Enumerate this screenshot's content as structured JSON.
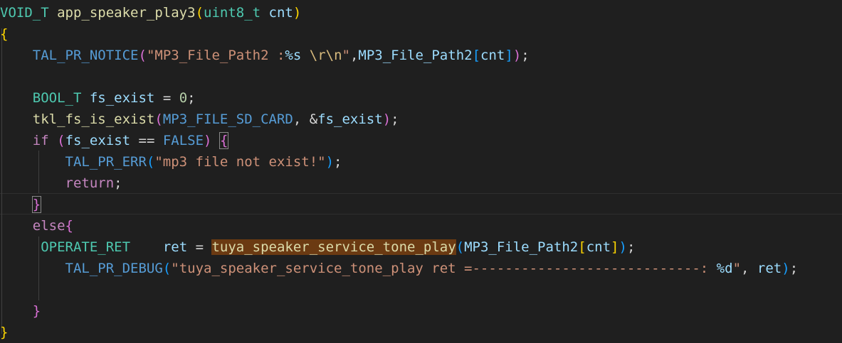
{
  "editor": {
    "lines": [
      {
        "tokens": [
          {
            "t": "VOID_T",
            "c": "kw-type"
          },
          {
            "t": " "
          },
          {
            "t": "app_speaker_play3",
            "c": "fn"
          },
          {
            "t": "(",
            "c": "b1"
          },
          {
            "t": "uint8_t",
            "c": "kw-type"
          },
          {
            "t": " "
          },
          {
            "t": "cnt",
            "c": "var"
          },
          {
            "t": ")",
            "c": "b1"
          }
        ]
      },
      {
        "tokens": [
          {
            "t": "{",
            "c": "b1"
          }
        ]
      },
      {
        "tokens": [
          {
            "t": "    "
          },
          {
            "t": "TAL_PR_NOTICE",
            "c": "mac"
          },
          {
            "t": "(",
            "c": "b2"
          },
          {
            "t": "\"MP3_File_Path2 :",
            "c": "str"
          },
          {
            "t": "%s",
            "c": "fmt"
          },
          {
            "t": " ",
            "c": "str"
          },
          {
            "t": "\\r\\n",
            "c": "esc"
          },
          {
            "t": "\"",
            "c": "str"
          },
          {
            "t": ","
          },
          {
            "t": "MP3_File_Path2",
            "c": "var"
          },
          {
            "t": "[",
            "c": "b3"
          },
          {
            "t": "cnt",
            "c": "var"
          },
          {
            "t": "]",
            "c": "b3"
          },
          {
            "t": ")",
            "c": "b2"
          },
          {
            "t": ";"
          }
        ]
      },
      {
        "tokens": []
      },
      {
        "tokens": [
          {
            "t": "    "
          },
          {
            "t": "BOOL_T",
            "c": "kw-type"
          },
          {
            "t": " "
          },
          {
            "t": "fs_exist",
            "c": "var"
          },
          {
            "t": " = "
          },
          {
            "t": "0",
            "c": "num"
          },
          {
            "t": ";"
          }
        ]
      },
      {
        "tokens": [
          {
            "t": "    "
          },
          {
            "t": "tkl_fs_is_exist",
            "c": "fn"
          },
          {
            "t": "(",
            "c": "b2"
          },
          {
            "t": "MP3_FILE_SD_CARD",
            "c": "mac"
          },
          {
            "t": ", &"
          },
          {
            "t": "fs_exist",
            "c": "var"
          },
          {
            "t": ")",
            "c": "b2"
          },
          {
            "t": ";"
          }
        ]
      },
      {
        "tokens": [
          {
            "t": "    "
          },
          {
            "t": "if",
            "c": "kw-ret"
          },
          {
            "t": " "
          },
          {
            "t": "(",
            "c": "b2"
          },
          {
            "t": "fs_exist",
            "c": "var"
          },
          {
            "t": " == "
          },
          {
            "t": "FALSE",
            "c": "mac"
          },
          {
            "t": ")",
            "c": "b2"
          },
          {
            "t": " "
          },
          {
            "t": "{",
            "c": "b2 hlb"
          }
        ]
      },
      {
        "tokens": [
          {
            "t": "        "
          },
          {
            "t": "TAL_PR_ERR",
            "c": "mac"
          },
          {
            "t": "(",
            "c": "b3"
          },
          {
            "t": "\"mp3 file not exist!\"",
            "c": "str"
          },
          {
            "t": ")",
            "c": "b3"
          },
          {
            "t": ";"
          }
        ]
      },
      {
        "tokens": [
          {
            "t": "        "
          },
          {
            "t": "return",
            "c": "kw-ret"
          },
          {
            "t": ";"
          }
        ]
      },
      {
        "tokens": [
          {
            "t": "    "
          },
          {
            "t": "}",
            "c": "b2 hlb"
          }
        ]
      },
      {
        "tokens": [
          {
            "t": "    "
          },
          {
            "t": "else",
            "c": "kw-ret"
          },
          {
            "t": "{",
            "c": "b2"
          }
        ]
      },
      {
        "tokens": [
          {
            "t": "     "
          },
          {
            "t": "OPERATE_RET",
            "c": "kw-type"
          },
          {
            "t": "    "
          },
          {
            "t": "ret",
            "c": "var"
          },
          {
            "t": " = "
          },
          {
            "t": "tuya_speaker_service_tone_play",
            "c": "fn hl"
          },
          {
            "t": "(",
            "c": "b3"
          },
          {
            "t": "MP3_File_Path2",
            "c": "var"
          },
          {
            "t": "[",
            "c": "b1"
          },
          {
            "t": "cnt",
            "c": "var"
          },
          {
            "t": "]",
            "c": "b1"
          },
          {
            "t": ")",
            "c": "b3"
          },
          {
            "t": ";"
          }
        ]
      },
      {
        "tokens": [
          {
            "t": "        "
          },
          {
            "t": "TAL_PR_DEBUG",
            "c": "mac"
          },
          {
            "t": "(",
            "c": "b3"
          },
          {
            "t": "\"tuya_speaker_service_tone_play ret =----------------------------: ",
            "c": "str"
          },
          {
            "t": "%d",
            "c": "fmt"
          },
          {
            "t": "\"",
            "c": "str"
          },
          {
            "t": ", "
          },
          {
            "t": "ret",
            "c": "var"
          },
          {
            "t": ")",
            "c": "b3"
          },
          {
            "t": ";"
          }
        ]
      },
      {
        "tokens": []
      },
      {
        "tokens": [
          {
            "t": "    "
          },
          {
            "t": "}",
            "c": "b2"
          }
        ]
      },
      {
        "tokens": [
          {
            "t": "}",
            "c": "b1"
          }
        ]
      }
    ]
  }
}
